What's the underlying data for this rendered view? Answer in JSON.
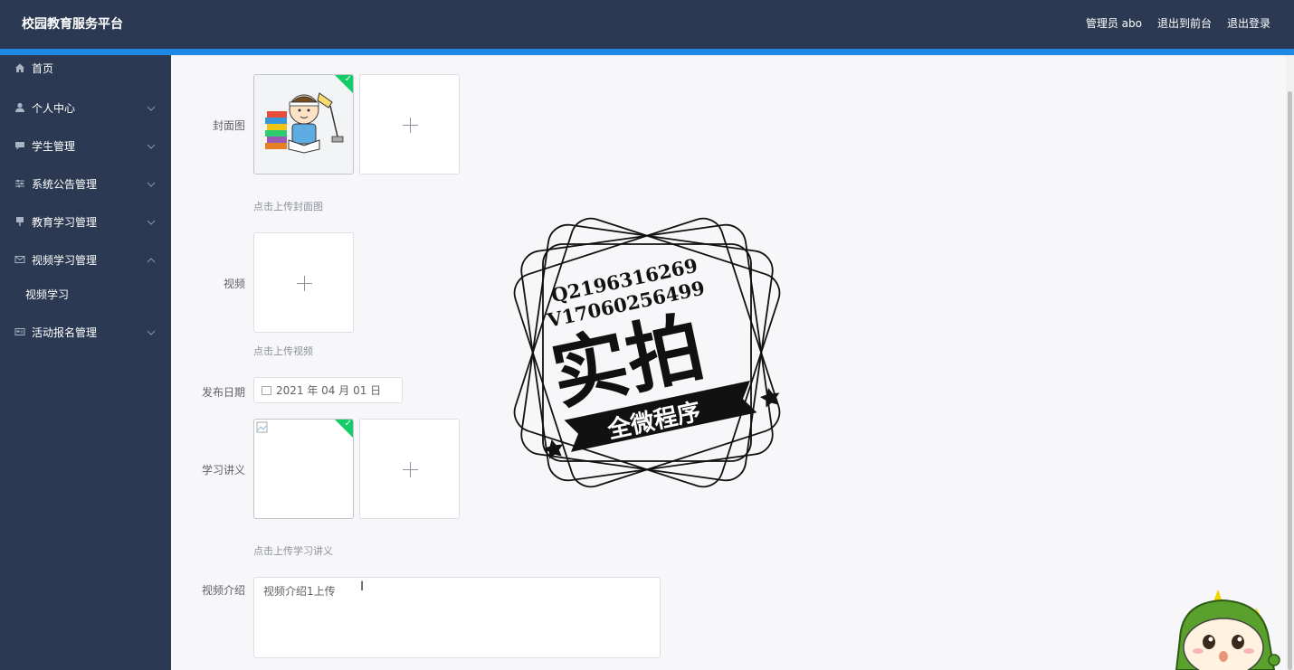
{
  "header": {
    "title": "校园教育服务平台",
    "admin_label": "管理员 abo",
    "front_label": "退出到前台",
    "logout_label": "退出登录"
  },
  "sidebar": {
    "items": [
      {
        "label": "首页"
      },
      {
        "label": "个人中心"
      },
      {
        "label": "学生管理"
      },
      {
        "label": "系统公告管理"
      },
      {
        "label": "教育学习管理"
      },
      {
        "label": "视频学习管理",
        "sub": "视频学习"
      },
      {
        "label": "活动报名管理"
      }
    ]
  },
  "form": {
    "cover_label": "封面图",
    "cover_hint": "点击上传封面图",
    "video_label": "视频",
    "video_hint": "点击上传视频",
    "date_label": "发布日期",
    "date_value": "2021 年 04 月 01 日",
    "notes_label": "学习讲义",
    "notes_hint": "点击上传学习讲义",
    "intro_label": "视频介绍",
    "intro_value": "视频介绍1上传"
  },
  "watermark": {
    "line1": "Q2196316269",
    "line2": "V17060256499",
    "big": "实拍",
    "banner": "全微程序"
  },
  "colors": {
    "topbar": "#2b3a52",
    "accent": "#1e88e5",
    "success": "#13ce66"
  }
}
